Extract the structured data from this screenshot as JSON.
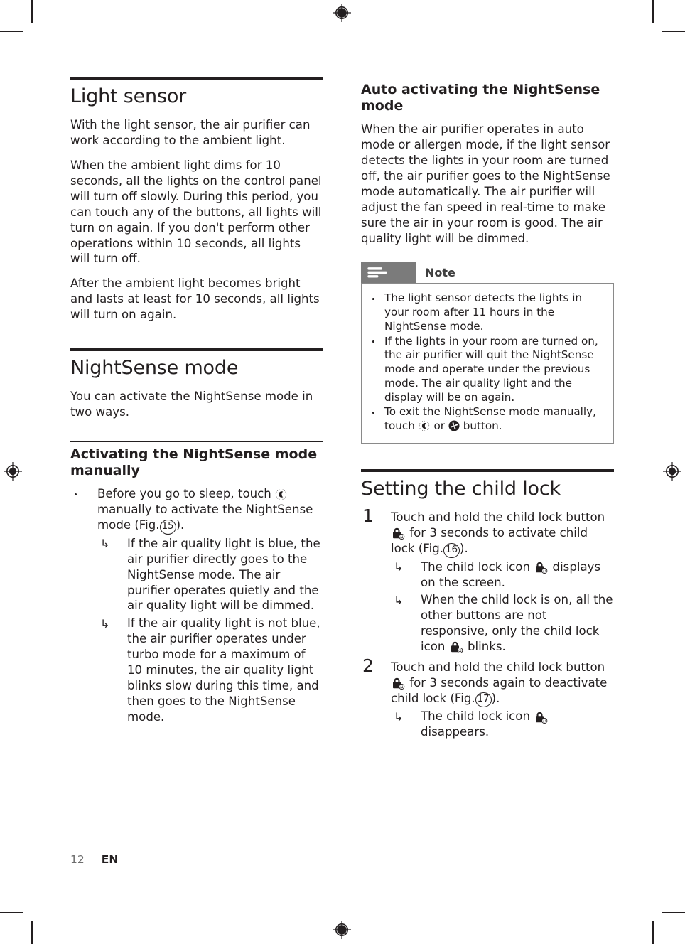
{
  "page": {
    "footer_page_number": "12",
    "footer_language": "EN"
  },
  "left_column": {
    "section1": {
      "heading": "Light sensor",
      "paragraphs": [
        "With the light sensor, the air purifier can work according to the ambient light.",
        "When the ambient light dims for 10 seconds, all the lights on the control panel will turn off slowly. During this period, you can touch any of the buttons, all lights will turn on again. If you don't perform other operations within 10 seconds, all lights will turn off.",
        "After the ambient light becomes bright and lasts at least for 10 seconds, all lights will turn on again."
      ]
    },
    "section2": {
      "heading": "NightSense mode",
      "intro": "You can activate the NightSense mode in two ways.",
      "subheading": "Activating the NightSense mode manually",
      "bullet": {
        "text_before_icon": "Before you go to sleep, touch ",
        "icon": "nightsense-moon-icon",
        "text_after_icon": " manually to activate the NightSense mode (Fig.",
        "figure_number": "15",
        "text_end": ")."
      },
      "arrow_items": [
        "If the air quality light is blue, the air purifier directly goes to the NightSense mode. The air purifier operates quietly and the air quality light will be dimmed.",
        "If the air quality light is not blue, the air purifier operates under turbo mode for a maximum of 10 minutes, the air quality light blinks slow during this time, and then goes to the NightSense mode."
      ]
    }
  },
  "right_column": {
    "section3": {
      "subheading": "Auto activating the NightSense mode",
      "paragraph": "When the air purifier operates in auto mode or allergen mode, if the light sensor detects the lights in your room are turned off, the air purifier goes to the NightSense mode automatically. The air purifier will adjust the fan speed in real-time to make sure the air in your room is good. The air quality light will be dimmed."
    },
    "note": {
      "label": "Note",
      "tab_icon": "note-lines-icon",
      "items": [
        "The light sensor detects the lights in your room after 11 hours in the NightSense mode.",
        "If the lights in your room are turned on, the air purifier will quit the NightSense mode and operate under the previous mode. The air quality light and the display will be on again."
      ],
      "last_item": {
        "text_start": "To exit the NightSense mode manually, touch ",
        "icon_moon": "nightsense-moon-icon",
        "text_or": " or ",
        "icon_fan": "fan-speed-icon",
        "text_end": " button."
      }
    },
    "section4": {
      "heading": "Setting the child lock",
      "steps": [
        {
          "number": "1",
          "text_start": "Touch and hold the child lock button ",
          "icon": "child-lock-icon",
          "text_mid": " for 3 seconds to activate child lock (Fig.",
          "figure_number": "16",
          "text_end": ").",
          "arrow_items": [
            {
              "text_start": "The child lock icon ",
              "icon": "child-lock-icon",
              "text_end": " displays on the screen."
            },
            {
              "text_start": "When the child lock is on, all the other buttons are not responsive, only the child lock icon ",
              "icon": "child-lock-icon",
              "text_end": " blinks."
            }
          ]
        },
        {
          "number": "2",
          "text_start": "Touch and hold the child lock button ",
          "icon": "child-lock-icon",
          "text_mid": " for 3 seconds again to deactivate child lock (Fig.",
          "figure_number": "17",
          "text_end": ").",
          "arrow_items": [
            {
              "text_start": "The child lock icon ",
              "icon": "child-lock-icon",
              "text_end": " disappears."
            }
          ]
        }
      ]
    }
  },
  "colors": {
    "ink": "#231f20",
    "note_tab_gray": "#7b7b7b",
    "note_border_gray": "#8a8a8a",
    "footer_page_gray": "#6d6d6d"
  },
  "marks": {
    "arrow_glyph": "↳"
  }
}
